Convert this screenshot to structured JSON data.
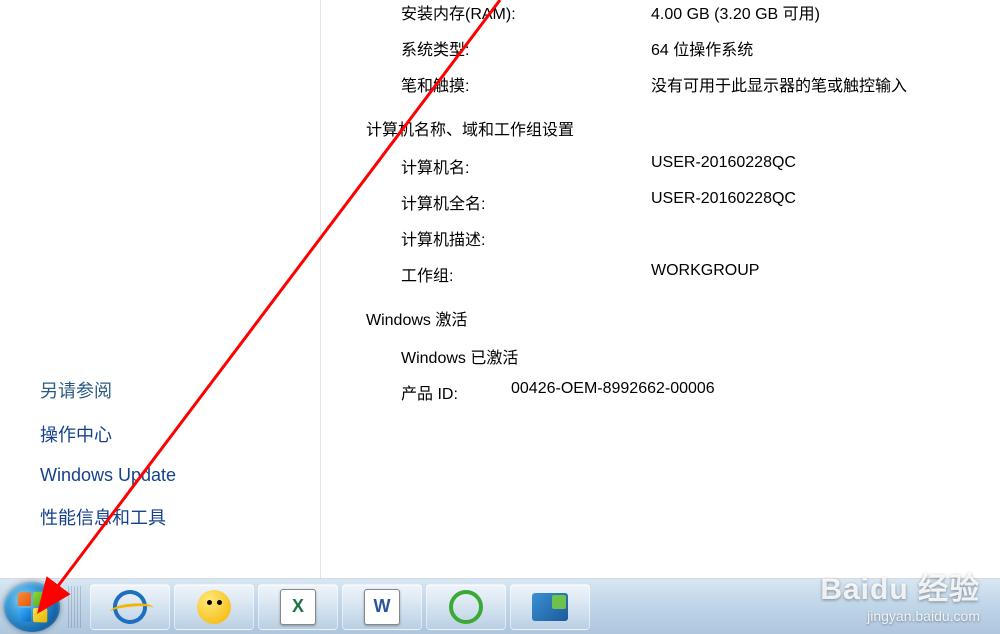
{
  "system_info": {
    "ram": {
      "label": "安装内存(RAM):",
      "value": "4.00 GB (3.20 GB 可用)"
    },
    "system_type": {
      "label": "系统类型:",
      "value": "64 位操作系统"
    },
    "pen_touch": {
      "label": "笔和触摸:",
      "value": "没有可用于此显示器的笔或触控输入"
    }
  },
  "computer_section": {
    "title": "计算机名称、域和工作组设置",
    "computer_name": {
      "label": "计算机名:",
      "value": "USER-20160228QC"
    },
    "full_name": {
      "label": "计算机全名:",
      "value": "USER-20160228QC"
    },
    "description": {
      "label": "计算机描述:",
      "value": ""
    },
    "workgroup": {
      "label": "工作组:",
      "value": "WORKGROUP"
    }
  },
  "activation_section": {
    "title": "Windows 激活",
    "status": "Windows 已激活",
    "product_id": {
      "label": "产品 ID:",
      "value": "00426-OEM-8992662-00006"
    }
  },
  "sidebar": {
    "title": "另请参阅",
    "links": [
      "操作中心",
      "Windows Update",
      "性能信息和工具"
    ]
  },
  "watermark": {
    "brand": "Baidu 经验",
    "url": "jingyan.baidu.com"
  },
  "taskbar_icons": [
    "start",
    "separator",
    "ie",
    "chick",
    "excel",
    "word",
    "green-browser",
    "control-panel"
  ]
}
